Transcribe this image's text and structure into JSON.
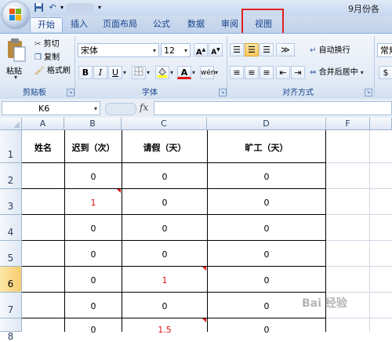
{
  "titlebar": {
    "doc_title": "9月份各"
  },
  "tabs": [
    {
      "label": "开始"
    },
    {
      "label": "插入"
    },
    {
      "label": "页面布局"
    },
    {
      "label": "公式"
    },
    {
      "label": "数据"
    },
    {
      "label": "审阅"
    },
    {
      "label": "视图"
    }
  ],
  "ribbon": {
    "clipboard": {
      "paste": "粘贴",
      "cut": "剪切",
      "copy": "复制",
      "format_painter": "格式刷",
      "group": "剪贴板"
    },
    "font": {
      "name": "宋体",
      "size": "12",
      "group": "字体",
      "bold": "B",
      "italic": "I",
      "underline": "U"
    },
    "alignment": {
      "wrap": "自动换行",
      "merge": "合并后居中",
      "group": "对齐方式"
    },
    "number": {
      "format": "常规"
    }
  },
  "formula_bar": {
    "cell_ref": "K6",
    "fx": "fx",
    "value": ""
  },
  "grid": {
    "columns": [
      "A",
      "B",
      "C",
      "D",
      "F"
    ],
    "headers": [
      "姓名",
      "迟到（次）",
      "请假（天）",
      "旷工（天）"
    ],
    "rows": [
      {
        "num": "1"
      },
      {
        "num": "2",
        "b": "0",
        "c": "0",
        "d": "0"
      },
      {
        "num": "3",
        "b": "1",
        "c": "0",
        "d": "0"
      },
      {
        "num": "4",
        "b": "0",
        "c": "0",
        "d": "0"
      },
      {
        "num": "5",
        "b": "0",
        "c": "0",
        "d": "0"
      },
      {
        "num": "6",
        "b": "0",
        "c": "1",
        "d": "0"
      },
      {
        "num": "7",
        "b": "0",
        "c": "0",
        "d": "0"
      },
      {
        "num": "8",
        "b": "0",
        "c": "1.5",
        "d": "0"
      }
    ]
  },
  "watermark": "Bai 经验",
  "colors": {
    "accent": "#15428b",
    "highlight": "#e02020",
    "red_text": "#e01414"
  }
}
